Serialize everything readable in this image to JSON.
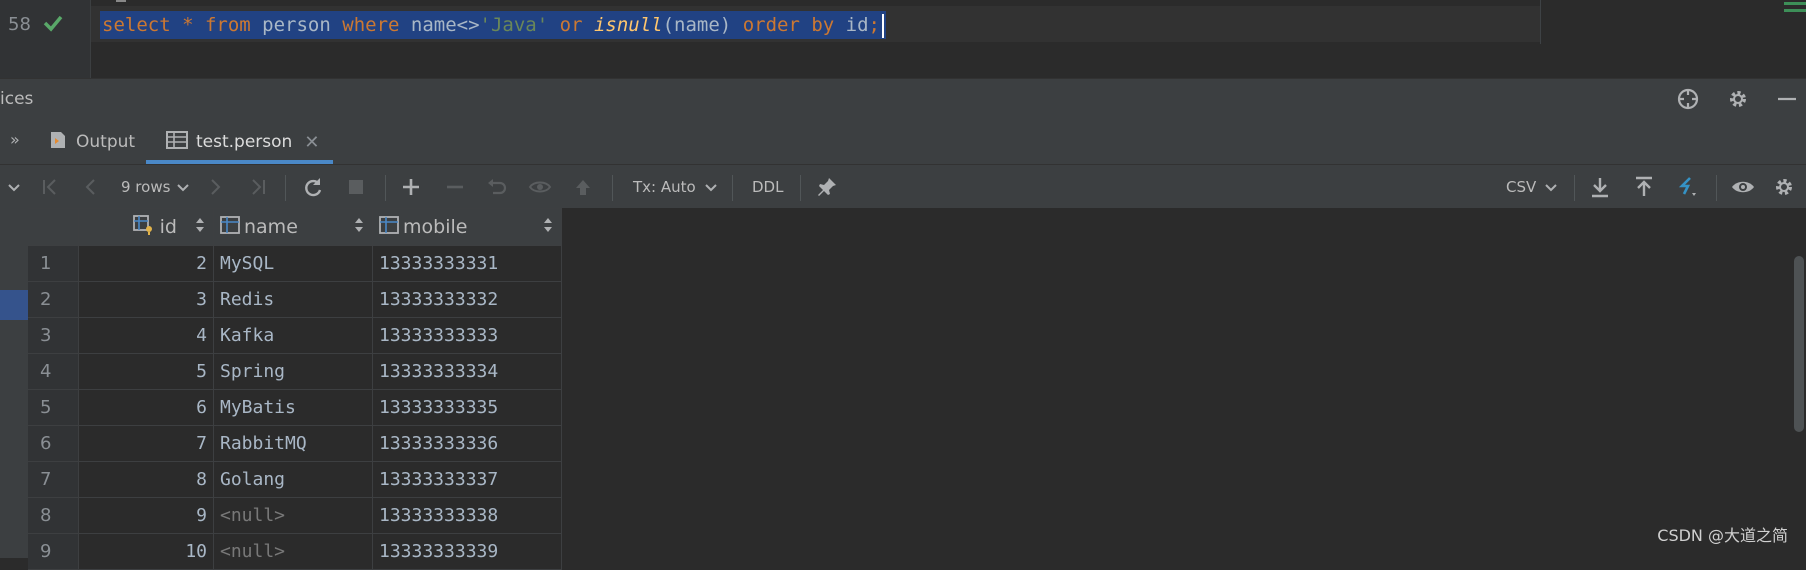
{
  "editor": {
    "line_number": "58",
    "code_tokens": [
      {
        "t": "select",
        "c": "kw"
      },
      {
        "t": " * ",
        "c": "kw"
      },
      {
        "t": "from",
        "c": "kw"
      },
      {
        "t": " person ",
        "c": "id"
      },
      {
        "t": "where",
        "c": "kw"
      },
      {
        "t": " name<>",
        "c": "id"
      },
      {
        "t": "'Java'",
        "c": "str"
      },
      {
        "t": " ",
        "c": "id"
      },
      {
        "t": "or",
        "c": "kw"
      },
      {
        "t": " ",
        "c": "id"
      },
      {
        "t": "isnull",
        "c": "fn"
      },
      {
        "t": "(name) ",
        "c": "id"
      },
      {
        "t": "order by",
        "c": "kw"
      },
      {
        "t": " id",
        "c": "id"
      },
      {
        "t": ";",
        "c": "kw"
      }
    ]
  },
  "services": {
    "title": "ices"
  },
  "tabs": [
    {
      "label": "Output",
      "icon": "output-icon"
    },
    {
      "label": "test.person",
      "icon": "table-icon"
    }
  ],
  "toolbar": {
    "rows_label": "9 rows",
    "tx_label": "Tx: Auto",
    "ddl_label": "DDL",
    "export_format": "CSV"
  },
  "grid": {
    "columns": [
      {
        "label": "id",
        "icon": "primary-key-column-icon"
      },
      {
        "label": "name",
        "icon": "column-icon"
      },
      {
        "label": "mobile",
        "icon": "column-icon"
      }
    ],
    "rows": [
      {
        "num": "1",
        "id": "2",
        "name": "MySQL",
        "mobile": "13333333331"
      },
      {
        "num": "2",
        "id": "3",
        "name": "Redis",
        "mobile": "13333333332"
      },
      {
        "num": "3",
        "id": "4",
        "name": "Kafka",
        "mobile": "13333333333"
      },
      {
        "num": "4",
        "id": "5",
        "name": "Spring",
        "mobile": "13333333334"
      },
      {
        "num": "5",
        "id": "6",
        "name": "MyBatis",
        "mobile": "13333333335"
      },
      {
        "num": "6",
        "id": "7",
        "name": "RabbitMQ",
        "mobile": "13333333336"
      },
      {
        "num": "7",
        "id": "8",
        "name": "Golang",
        "mobile": "13333333337"
      },
      {
        "num": "8",
        "id": "9",
        "name": "<null>",
        "mobile": "13333333338"
      },
      {
        "num": "9",
        "id": "10",
        "name": "<null>",
        "mobile": "13333333339"
      }
    ]
  },
  "watermark": "CSDN @大道之简",
  "colors": {
    "keyword": "#cc7832",
    "string": "#6a8759",
    "function": "#ffc66d",
    "selection": "#214283",
    "accent": "#4a88c7"
  }
}
